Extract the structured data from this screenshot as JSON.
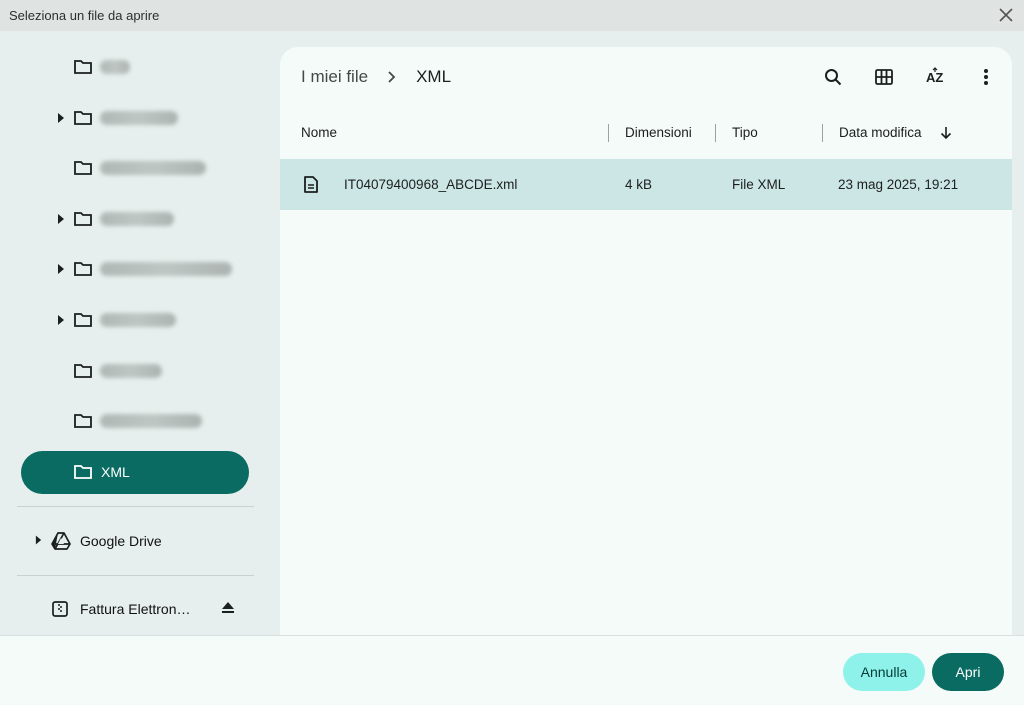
{
  "window": {
    "title": "Seleziona un file da aprire"
  },
  "sidebar": {
    "selected_folder": "XML",
    "volumes": [
      {
        "label": "Google Drive",
        "icon": "google-drive-icon"
      },
      {
        "label": "Fattura Elettron…",
        "icon": "sd-card-icon"
      }
    ]
  },
  "breadcrumb": {
    "root": "I miei file",
    "current": "XML"
  },
  "toolbar": {
    "search_icon": "search-icon",
    "grid_icon": "grid-view-icon",
    "sort_icon": "sort-az-icon",
    "more_icon": "more-vert-icon"
  },
  "table": {
    "columns": [
      "Nome",
      "Dimensioni",
      "Tipo",
      "Data modifica"
    ],
    "rows": [
      {
        "name": "IT04079400968_ABCDE.xml",
        "size": "4 kB",
        "type": "File XML",
        "modified": "23 mag 2025, 19:21"
      }
    ]
  },
  "footer": {
    "cancel": "Annulla",
    "open": "Apri"
  },
  "colors": {
    "accent": "#0a6b63",
    "selection": "#cce6e6",
    "cancel_bg": "#8ff2ea"
  }
}
